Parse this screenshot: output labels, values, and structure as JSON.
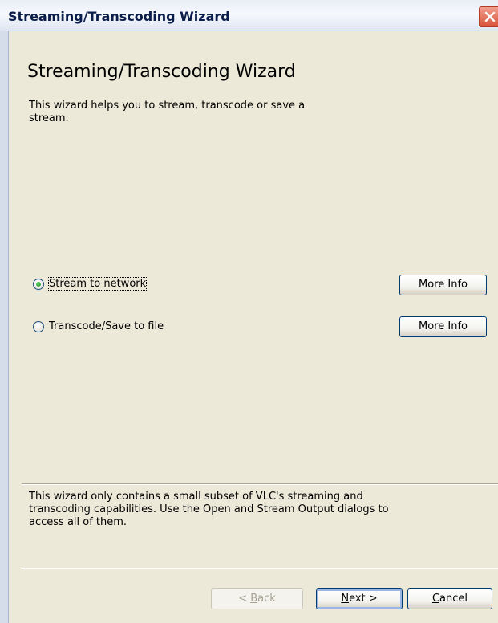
{
  "window": {
    "title": "Streaming/Transcoding Wizard"
  },
  "heading": "Streaming/Transcoding Wizard",
  "description": "This wizard helps you to stream, transcode or save a stream.",
  "options": [
    {
      "label": "Stream to network",
      "checked": true,
      "more_info": "More Info"
    },
    {
      "label": "Transcode/Save to file",
      "checked": false,
      "more_info": "More Info"
    }
  ],
  "note": "This wizard only contains a small subset of VLC's streaming and transcoding capabilities. Use the Open and Stream Output dialogs to access all of them.",
  "buttons": {
    "back_prefix": "< ",
    "back_mnemonic": "B",
    "back_rest": "ack",
    "next_mnemonic": "N",
    "next_rest": "ext >",
    "cancel_mnemonic": "C",
    "cancel_rest": "ancel"
  },
  "colors": {
    "title_text": "#0b1d49",
    "dialog_bg": "#ece9d8",
    "close": "#d9533a"
  },
  "icons": {
    "close": "close-icon"
  }
}
